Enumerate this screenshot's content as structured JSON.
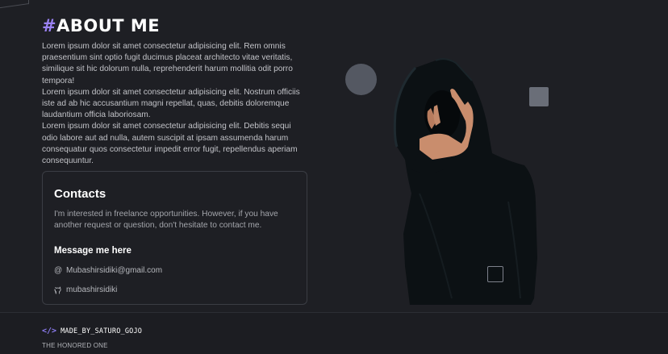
{
  "about": {
    "title_hash": "#",
    "title": "ABOUT ME",
    "paragraphs": [
      "Lorem ipsum dolor sit amet consectetur adipisicing elit. Rem omnis praesentium sint optio fugit ducimus placeat architecto vitae veritatis, similique sit hic dolorum nulla, reprehenderit harum mollitia odit porro tempora!",
      "Lorem ipsum dolor sit amet consectetur adipisicing elit. Nostrum officiis iste ad ab hic accusantium magni repellat, quas, debitis doloremque laudantium officia laboriosam.",
      "Lorem ipsum dolor sit amet consectetur adipisicing elit. Debitis sequi odio labore aut ad nulla, autem suscipit at ipsam assumenda harum consequatur quos consectetur impedit error fugit, repellendus aperiam consequuntur."
    ]
  },
  "contacts": {
    "title": "Contacts",
    "description": "I'm interested in freelance opportunities. However, if you have another request or question, don't hesitate to contact me.",
    "message_title": "Message me here",
    "email_icon": "at-icon",
    "email": "Mubashirsidiki@gmail.com",
    "github_icon": "github-icon",
    "github": "mubashirsidiki"
  },
  "footer": {
    "brand_icon": "code-icon",
    "brand": "MADE_BY_SATURO_GOJO",
    "tagline": "THE HONORED ONE"
  },
  "colors": {
    "background": "#1e1f24",
    "accent": "#9b82f3",
    "heading": "#ffffff"
  }
}
